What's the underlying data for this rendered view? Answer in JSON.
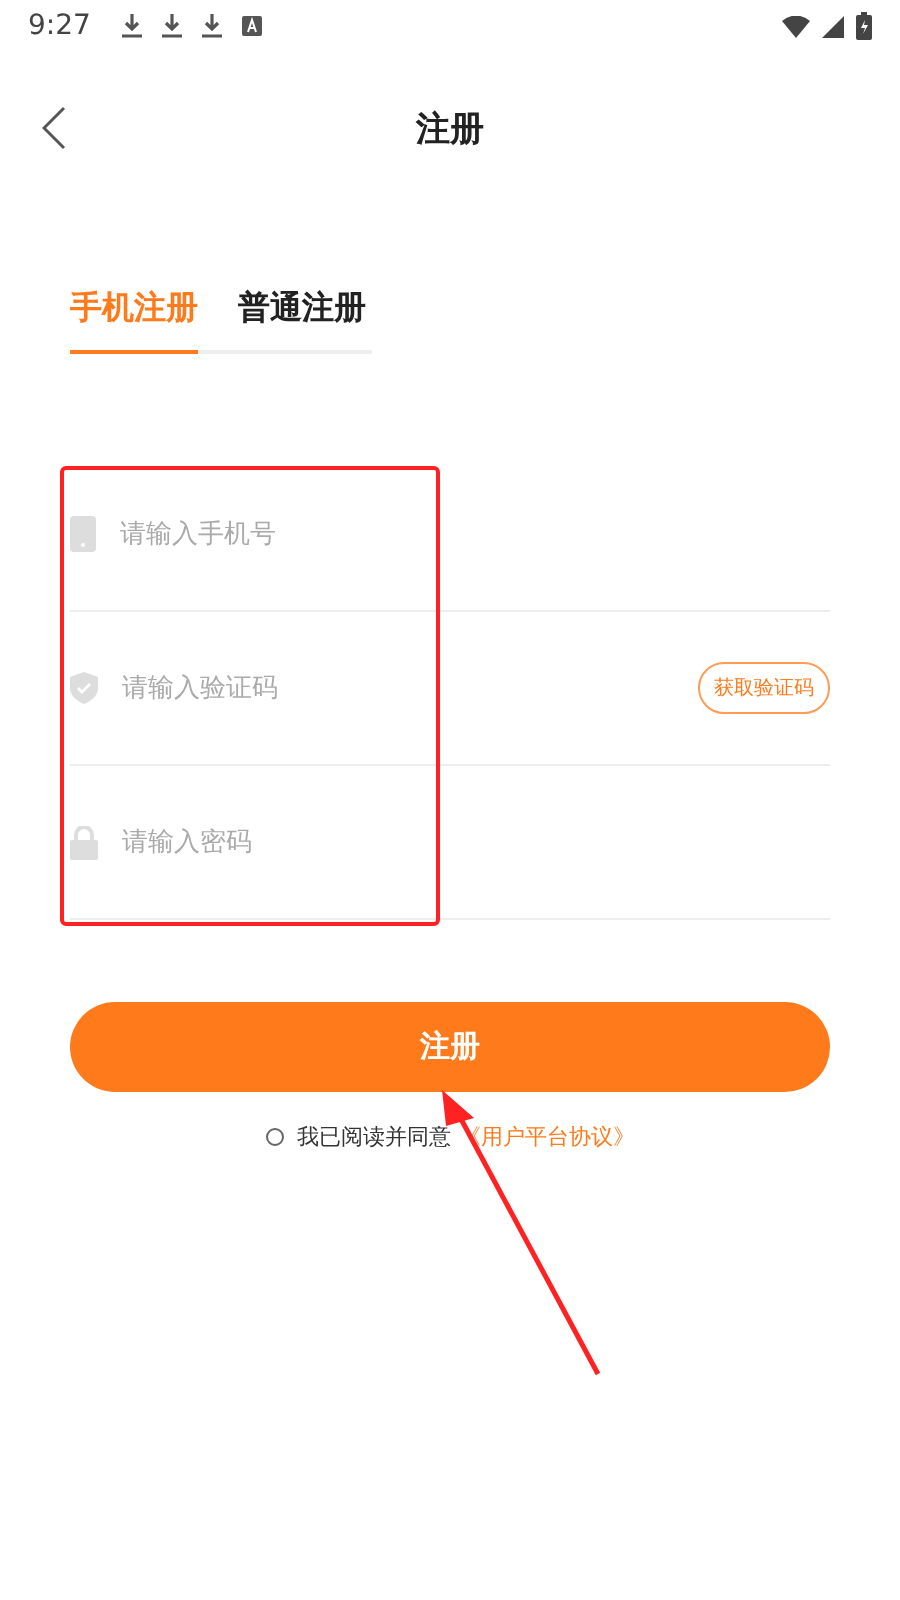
{
  "status_bar": {
    "time": "9:27"
  },
  "header": {
    "title": "注册"
  },
  "tabs": [
    {
      "label": "手机注册",
      "selected": true
    },
    {
      "label": "普通注册",
      "selected": false
    }
  ],
  "fields": [
    {
      "kind": "phone",
      "placeholder": "请输入手机号"
    },
    {
      "kind": "code",
      "placeholder": "请输入验证码",
      "action": "获取验证码"
    },
    {
      "kind": "password",
      "placeholder": "请输入密码"
    }
  ],
  "submit": "注册",
  "agreement": {
    "checked": false,
    "text": "我已阅读并同意",
    "link": "《用户平台协议》"
  }
}
